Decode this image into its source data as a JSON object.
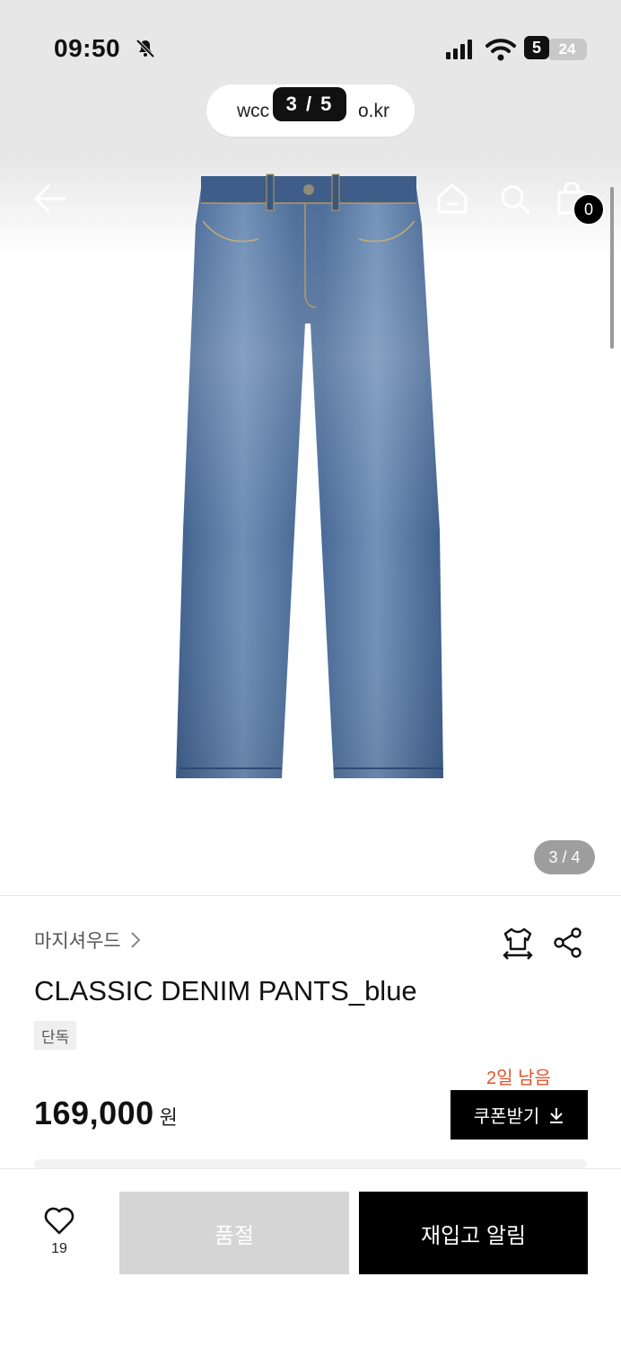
{
  "status_bar": {
    "time": "09:50",
    "network_badge": "5",
    "battery": "24"
  },
  "browser": {
    "url_prefix": "wcc",
    "url_suffix": "o.kr",
    "page_counter": "3 / 5"
  },
  "header": {
    "cart_count": "0"
  },
  "gallery": {
    "image_counter": "3 / 4"
  },
  "product": {
    "brand": "마지셔우드",
    "title": "CLASSIC DENIM PANTS_blue",
    "tag": "단독",
    "price": "169,000",
    "price_unit": "원",
    "coupon_remaining": "2일 남음",
    "coupon_label": "쿠폰받기"
  },
  "bottom_bar": {
    "wish_count": "19",
    "soldout_label": "품절",
    "restock_label": "재입고 알림"
  },
  "colors": {
    "accent": "#e0542c",
    "primary": "#000000",
    "disabled": "#d5d5d5",
    "denim": "#4d6f9a"
  }
}
